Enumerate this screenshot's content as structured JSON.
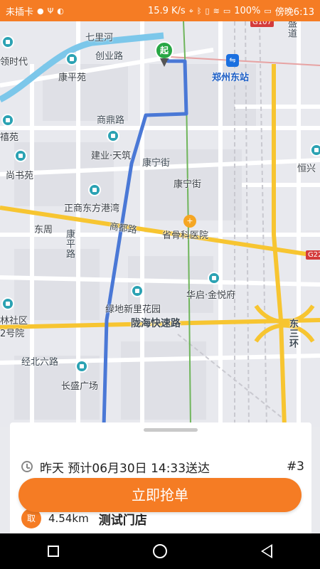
{
  "status_bar": {
    "carrier": "未插卡",
    "network_speed": "15.9 K/s",
    "battery": "100%",
    "time": "傍晚6:13"
  },
  "map": {
    "start_pin_label": "起",
    "labels": {
      "qilihe": "七里河",
      "chuangye_road": "创业路",
      "kangping_yuan": "康平苑",
      "shangding_road": "商鼎路",
      "jianye_tianzhu": "建业·天筑",
      "kangning_street": "康宁街",
      "kangning_street_2": "康宁街",
      "zhengshang_dongfang": "正商东方港湾",
      "shangdu_road": "商都路",
      "dongzhou": "东周",
      "kangping_road": "康平路",
      "shenggu_hospital": "省骨科医院",
      "huaqi_jinyue": "华启·金悦府",
      "lvdi_xinli": "绿地新里花园",
      "longhai_expressway": "陇海快速路",
      "jingbei_6_road": "经北六路",
      "changsheng_plaza": "长盛广场",
      "zhengzhou_east_station": "郑州东站",
      "east_3rd_ring": "东三环",
      "hengxing": "恒兴",
      "shangshuyuan": "尚书苑",
      "xiyuan": "禧苑",
      "lingdu_era": "领时代",
      "lin_district": "林社区",
      "no2_yard": "2号院",
      "g107": "G107",
      "g220": "G22",
      "top_right_road": "盛道"
    }
  },
  "order": {
    "time_text": "昨天 预计06月30日 14:33送达",
    "order_number": "#3",
    "grab_button_label": "立即抢单",
    "pickup_badge": "取",
    "distance": "4.54km",
    "store_name": "测试门店"
  },
  "colors": {
    "accent": "#f57c24",
    "route": "#4a78d6",
    "expressway": "#f7c531"
  }
}
